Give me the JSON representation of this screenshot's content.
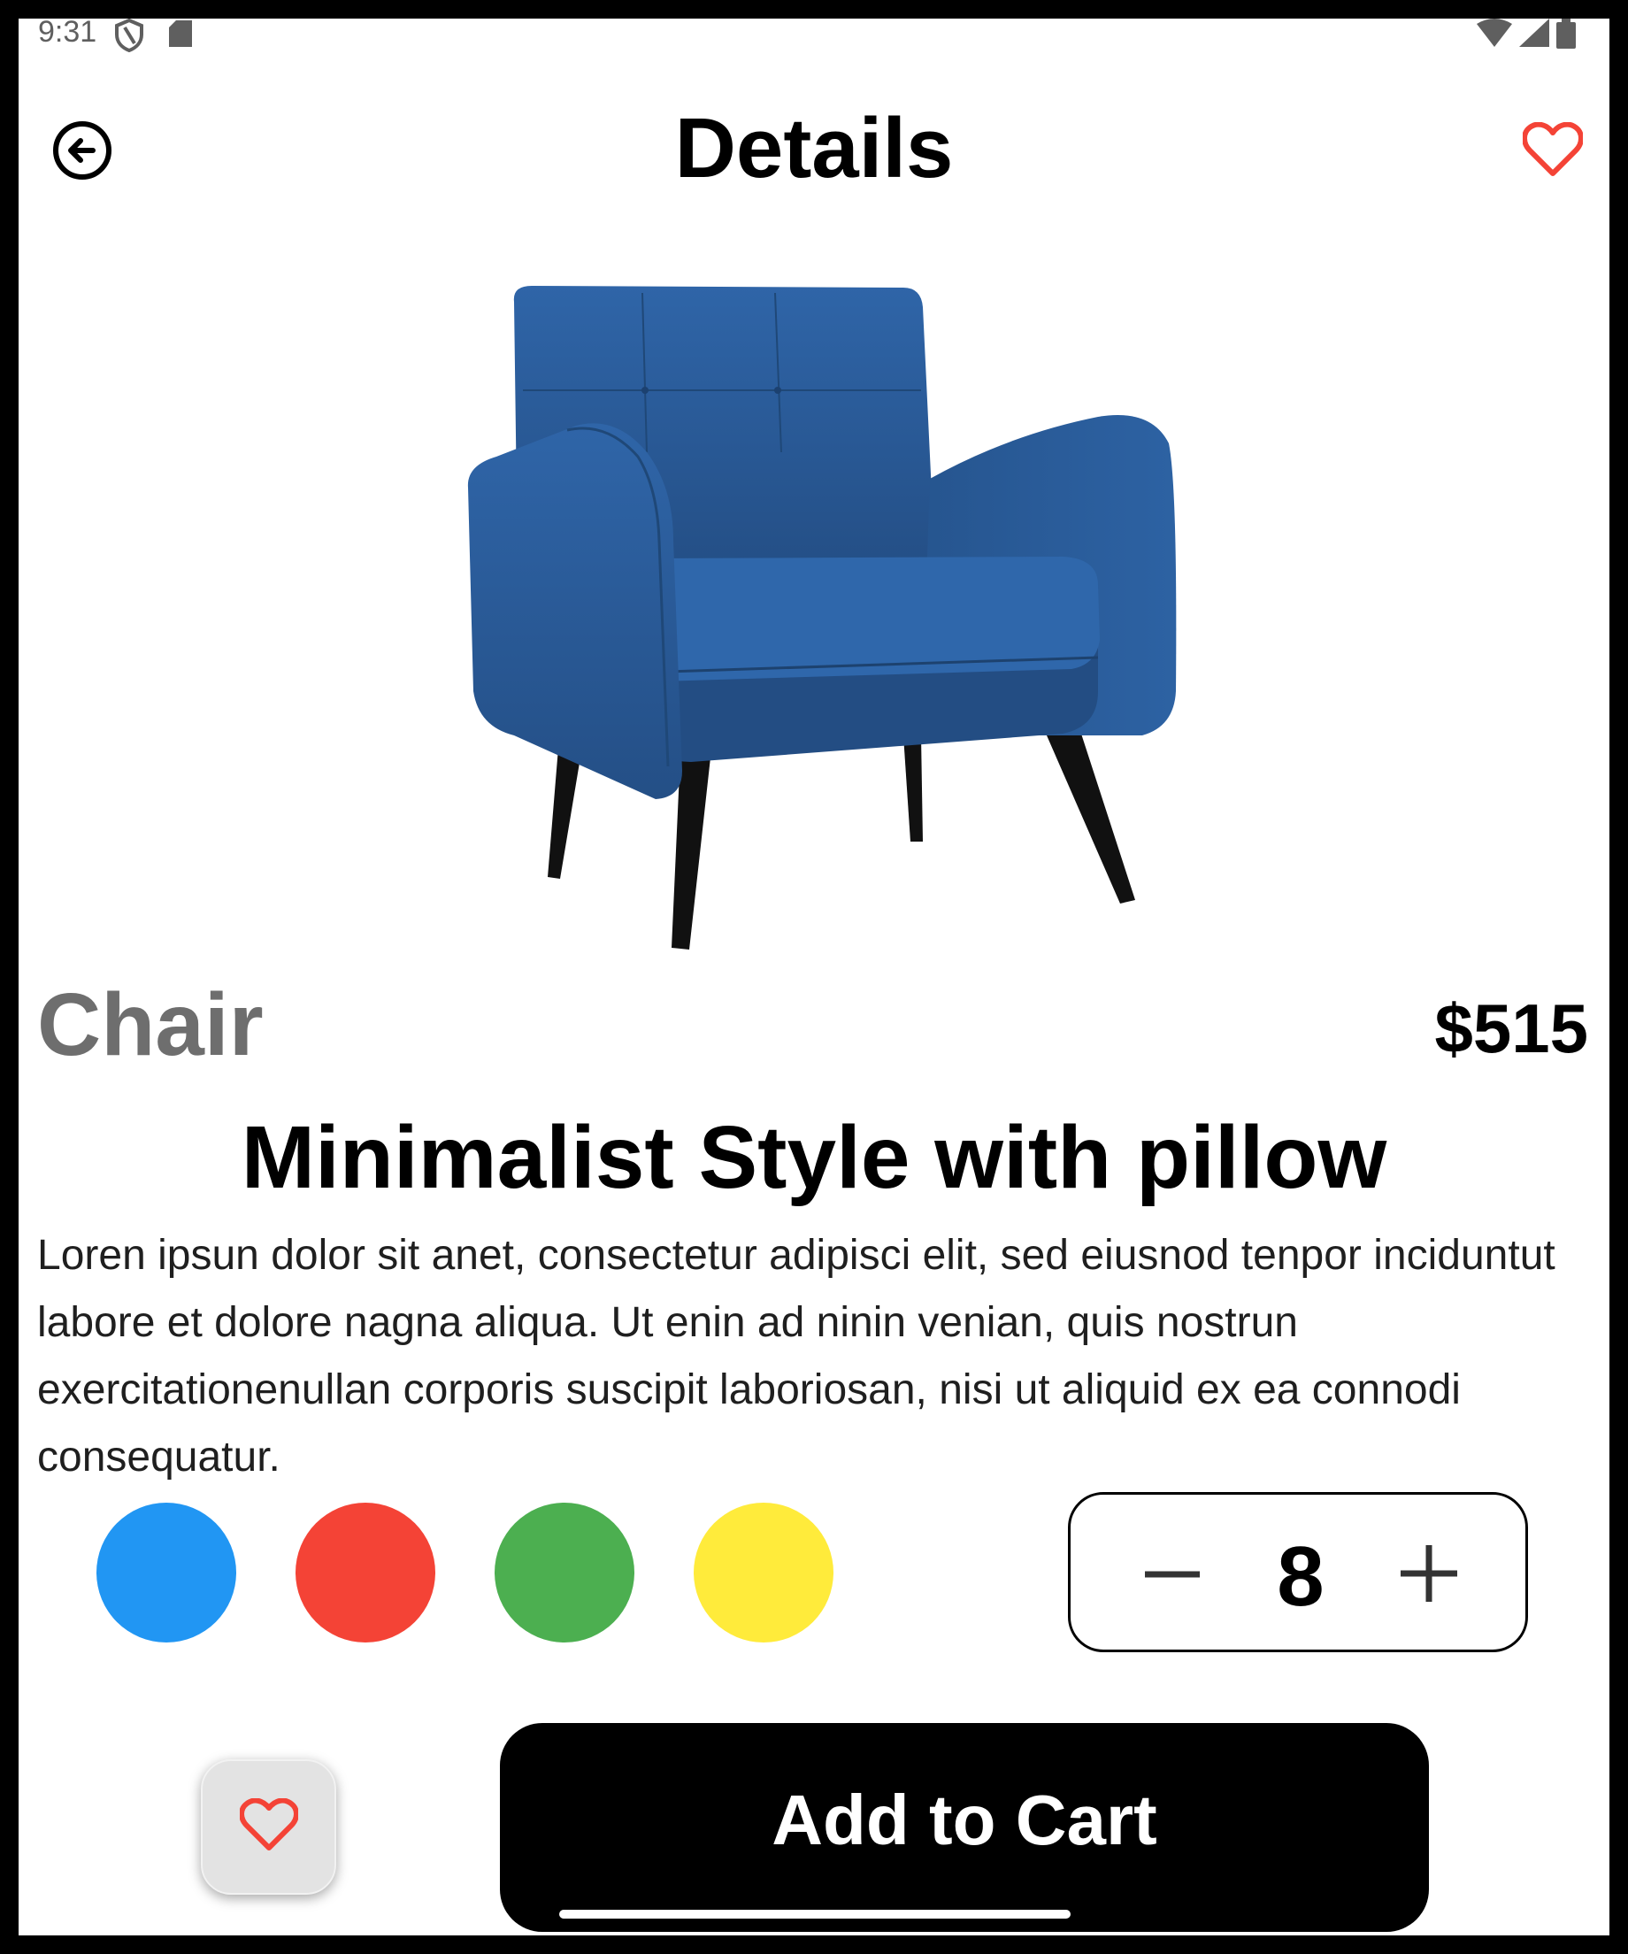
{
  "status_bar": {
    "time": "9:31",
    "icons": [
      "shield-icon",
      "sd-card-icon",
      "wifi-icon",
      "signal-icon",
      "battery-icon"
    ]
  },
  "header": {
    "title": "Details",
    "back_icon": "arrow-left-circle-icon",
    "favorite_icon": "heart-outline-icon",
    "favorite_color": "#f44336"
  },
  "product": {
    "image": "blue-armchair",
    "category": "Chair",
    "price": "$515",
    "title": "Minimalist Style with pillow",
    "description": "Loren ipsun dolor sit anet, consectetur adipisci elit, sed eiusnod tenpor inciduntut labore et dolore nagna aliqua. Ut enin ad ninin venian, quis nostrun exercitationenullan corporis suscipit laboriosan, nisi ut aliquid ex ea connodi consequatur."
  },
  "colors": [
    "#2196f3",
    "#f44336",
    "#4caf50",
    "#ffeb3b"
  ],
  "quantity": {
    "value": "8",
    "minus_icon": "minus-icon",
    "plus_icon": "plus-icon"
  },
  "actions": {
    "favorite_icon": "heart-outline-icon",
    "add_to_cart_label": "Add to Cart"
  }
}
